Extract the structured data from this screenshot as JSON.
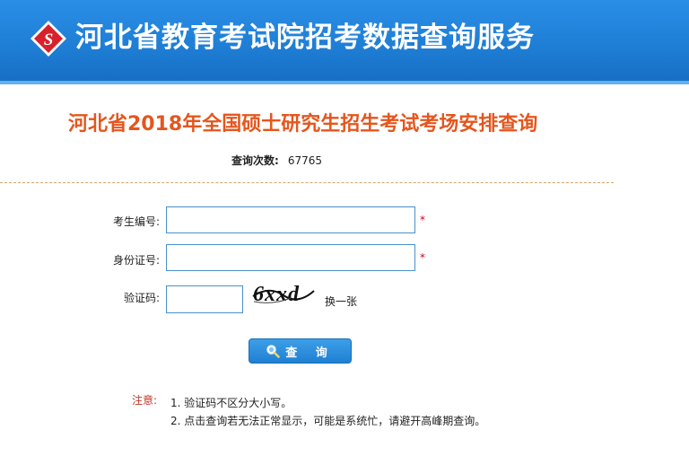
{
  "header": {
    "site_title": "河北省教育考试院招考数据查询服务"
  },
  "page": {
    "title": "河北省2018年全国硕士研究生招生考试考场安排查询"
  },
  "counter": {
    "label": "查询次数:",
    "value": "67765"
  },
  "form": {
    "exam_no_label": "考生编号:",
    "exam_no_value": "",
    "id_no_label": "身份证号:",
    "id_no_value": "",
    "captcha_label": "验证码:",
    "captcha_value": "",
    "captcha_text": "6xxd",
    "required_mark": "*",
    "refresh_label": "换一张",
    "submit_label": "查 询"
  },
  "notes": {
    "label": "注意:",
    "items": [
      "1. 验证码不区分大小写。",
      "2. 点击查询若无法正常显示，可能是系统忙，请避开高峰期查询。"
    ]
  },
  "colors": {
    "header_blue": "#1f7fd6",
    "title_orange": "#e4561e",
    "required_red": "#d0021b",
    "logo_red": "#d8212a"
  }
}
